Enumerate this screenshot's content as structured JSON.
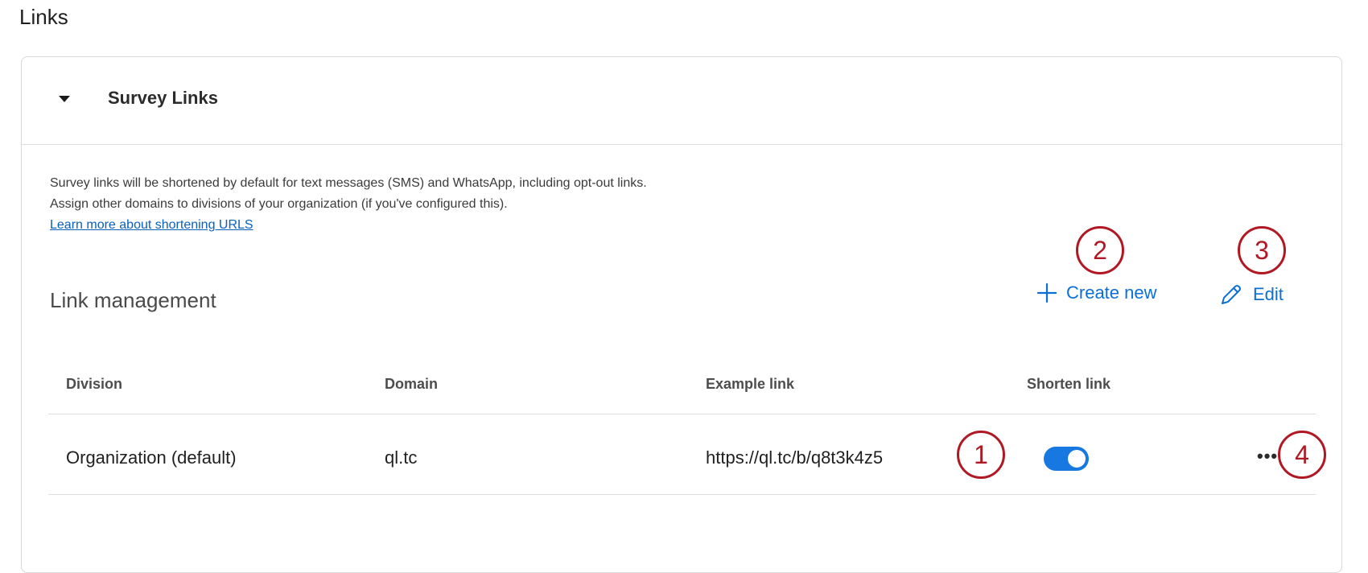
{
  "page": {
    "title": "Links"
  },
  "card": {
    "title": "Survey Links",
    "description_line1": "Survey links will be shortened by default for text messages (SMS) and WhatsApp, including opt-out links.",
    "description_line2": "Assign other domains to divisions of your organization (if you've configured this).",
    "learn_more": "Learn more about shortening URLS"
  },
  "link_management": {
    "title": "Link management",
    "create_label": "Create new",
    "edit_label": "Edit"
  },
  "table": {
    "headers": [
      "Division",
      "Domain",
      "Example link",
      "Shorten link"
    ],
    "rows": [
      {
        "division": "Organization (default)",
        "domain": "ql.tc",
        "example_link": "https://ql.tc/b/q8t3k4z5",
        "shorten": true,
        "more": "•••"
      }
    ]
  },
  "annotations": [
    "1",
    "2",
    "3",
    "4"
  ],
  "colors": {
    "accent": "#1778e2",
    "link": "#0b6fd8",
    "marker": "#b01923"
  },
  "icons": {
    "collapse": "caret-down-icon",
    "create": "plus-icon",
    "edit": "pencil-icon",
    "more": "more-horizontal-icon"
  }
}
